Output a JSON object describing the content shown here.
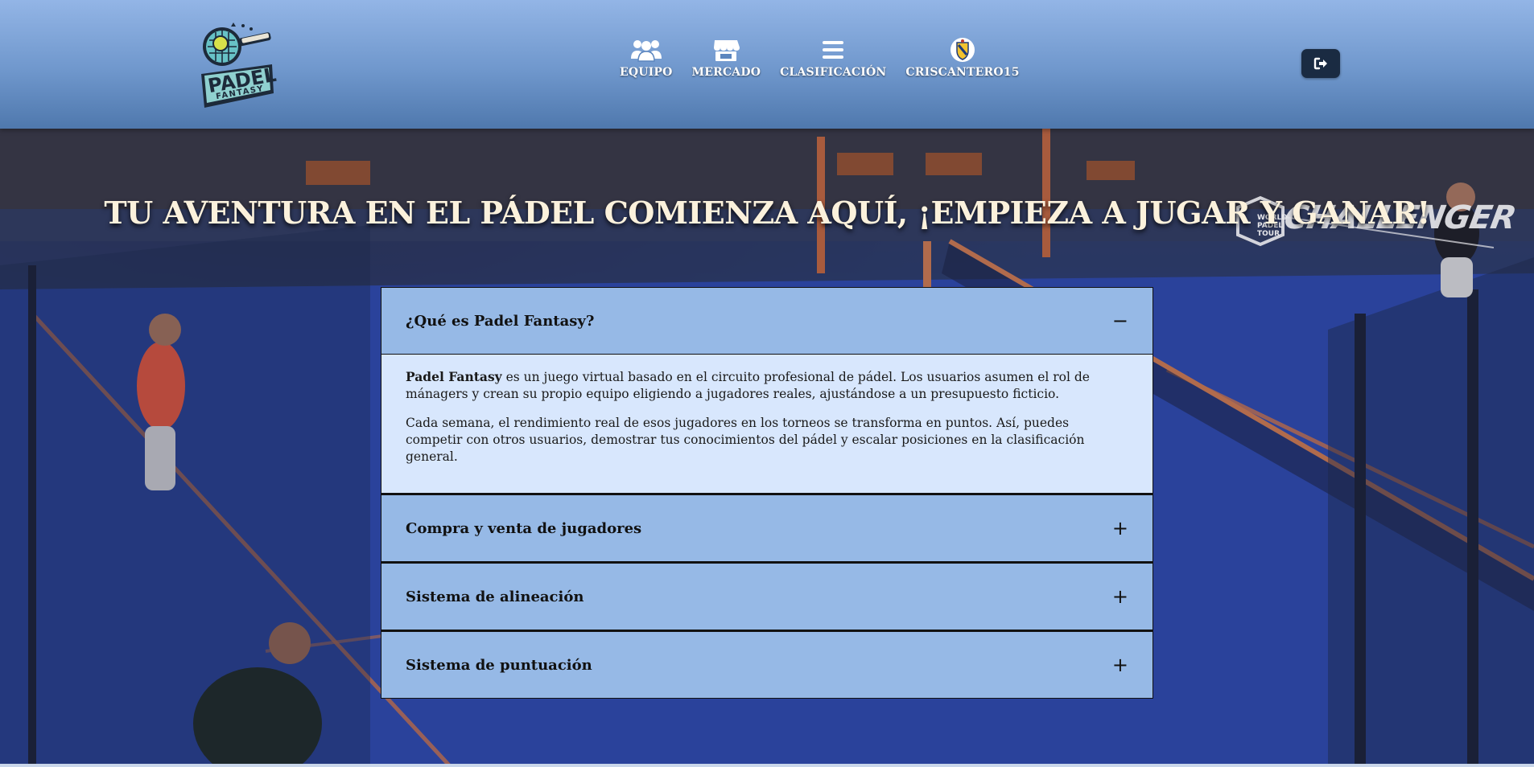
{
  "header": {
    "logo": {
      "line1": "PADEL",
      "line2": "FANTASY",
      "icon": "padel-racket-logo"
    },
    "nav": [
      {
        "label": "EQUIPO",
        "icon": "users-icon"
      },
      {
        "label": "MERCADO",
        "icon": "store-icon"
      },
      {
        "label": "CLASIFICACIÓN",
        "icon": "bars-icon"
      },
      {
        "label": "CRISCANTERO15",
        "icon": "team-crest-icon"
      }
    ],
    "logout": {
      "icon": "sign-out-icon"
    }
  },
  "hero": {
    "title": "TU AVENTURA EN EL PÁDEL COMIENZA AQUÍ, ¡EMPIEZA A JUGAR Y GANAR!",
    "badge": {
      "word": "CHALLENGER",
      "small1": "WORLD",
      "small2": "PADEL",
      "small3": "TOUR"
    }
  },
  "accordion": {
    "items": [
      {
        "title": "¿Qué es Padel Fantasy?",
        "toggle": "−",
        "expanded": true,
        "p1_bold": "Padel Fantasy",
        "p1_rest": " es un juego virtual basado en el circuito profesional de pádel. Los usuarios asumen el rol de mánagers y crean su propio equipo eligiendo a jugadores reales, ajustándose a un presupuesto ficticio.",
        "p2": "Cada semana, el rendimiento real de esos jugadores en los torneos se transforma en puntos. Así, puedes competir con otros usuarios, demostrar tus conocimientos del pádel y escalar posiciones en la clasificación general."
      },
      {
        "title": "Compra y venta de jugadores",
        "toggle": "+",
        "expanded": false
      },
      {
        "title": "Sistema de alineación",
        "toggle": "+",
        "expanded": false
      },
      {
        "title": "Sistema de puntuación",
        "toggle": "+",
        "expanded": false
      }
    ]
  },
  "colors": {
    "header_top": "#93b5e6",
    "header_bottom": "#4f78ad",
    "accordion_header": "#96b9e6",
    "accordion_body": "#d8e7fd",
    "court_blue": "#2c47a8",
    "title_text": "#fbf1dc",
    "logout_bg": "#1a2b42"
  }
}
